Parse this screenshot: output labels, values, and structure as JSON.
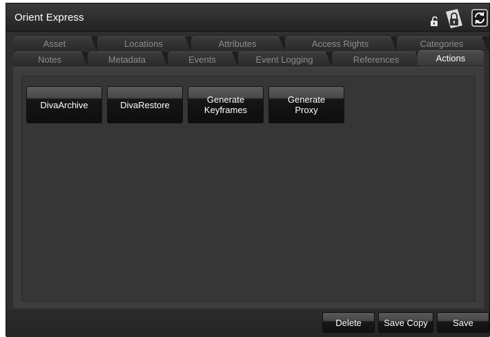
{
  "window": {
    "title": "Orient Express"
  },
  "titlebar_icons": [
    "small-lock-icon",
    "lock-icon",
    "refresh-icon"
  ],
  "tabs_back": [
    {
      "label": "Asset"
    },
    {
      "label": "Locations"
    },
    {
      "label": "Attributes"
    },
    {
      "label": "Access Rights"
    },
    {
      "label": "Categories"
    }
  ],
  "tabs_front": [
    {
      "label": "Notes"
    },
    {
      "label": "Metadata"
    },
    {
      "label": "Events"
    },
    {
      "label": "Event Logging"
    },
    {
      "label": "References"
    },
    {
      "label": "Actions",
      "active": true
    }
  ],
  "actions": [
    {
      "label": "DivaArchive"
    },
    {
      "label": "DivaRestore"
    },
    {
      "label": "Generate\nKeyframes"
    },
    {
      "label": "Generate\nProxy"
    }
  ],
  "footer": {
    "delete_label": "Delete",
    "save_copy_label": "Save Copy",
    "save_label": "Save"
  },
  "colors": {
    "background": "#2f2f2f",
    "active_tab_text": "#ffffff",
    "inactive_tab_text": "#8d8d8d"
  }
}
